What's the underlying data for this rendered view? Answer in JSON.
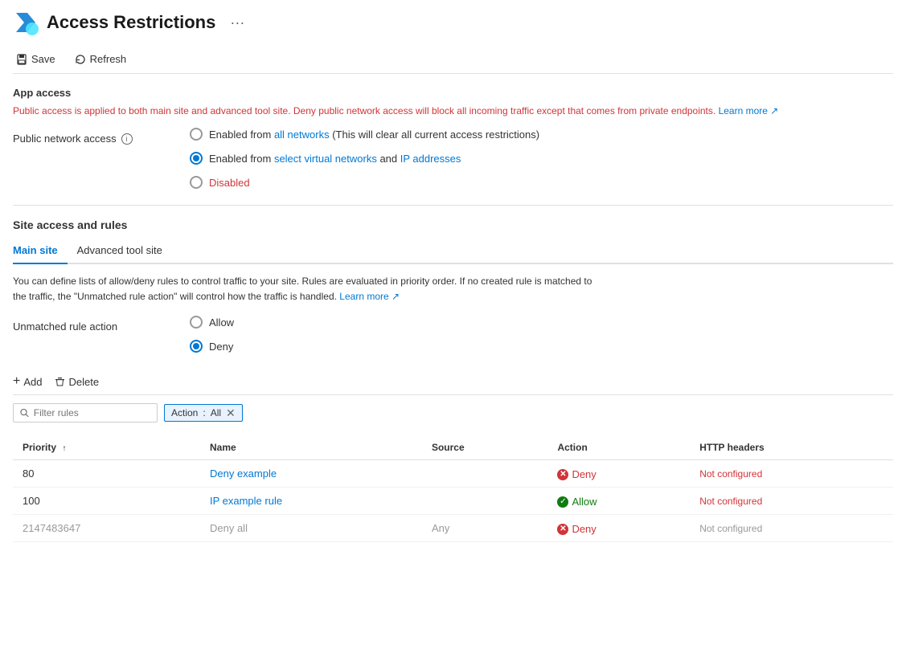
{
  "header": {
    "title": "Access Restrictions",
    "dots_label": "···"
  },
  "toolbar": {
    "save_label": "Save",
    "refresh_label": "Refresh"
  },
  "app_access": {
    "section_title": "App access",
    "info_text": "Public access is applied to both main site and advanced tool site. Deny public network access will block all incoming traffic except that comes from private endpoints.",
    "learn_more_label": "Learn more"
  },
  "public_network_access": {
    "label": "Public network access",
    "info_icon": "i",
    "options": [
      {
        "id": "all-networks",
        "label_start": "Enabled from ",
        "label_blue": "all networks",
        "label_end": " (This will clear all current access restrictions)",
        "selected": false
      },
      {
        "id": "select-networks",
        "label_start": "Enabled from ",
        "label_blue_1": "select virtual networks",
        "label_middle": " and ",
        "label_blue_2": "IP addresses",
        "selected": true
      },
      {
        "id": "disabled",
        "label": "Disabled",
        "selected": false
      }
    ]
  },
  "site_access": {
    "section_title": "Site access and rules",
    "tabs": [
      {
        "id": "main-site",
        "label": "Main site",
        "active": true
      },
      {
        "id": "advanced-tool-site",
        "label": "Advanced tool site",
        "active": false
      }
    ],
    "info_text_1": "You can define lists of allow/deny rules to control traffic to your site. Rules are evaluated in priority order. If no created rule is matched to",
    "info_text_2": "the traffic, the \"Unmatched rule action\" will control how the traffic is handled.",
    "learn_more_label": "Learn more"
  },
  "unmatched_rule": {
    "label": "Unmatched rule action",
    "options": [
      {
        "id": "allow",
        "label": "Allow",
        "selected": false
      },
      {
        "id": "deny",
        "label": "Deny",
        "selected": true
      }
    ]
  },
  "actions": {
    "add_label": "Add",
    "delete_label": "Delete"
  },
  "filter": {
    "placeholder": "Filter rules",
    "tag_label": "Action",
    "tag_separator": " : ",
    "tag_value": "All"
  },
  "table": {
    "columns": [
      {
        "id": "priority",
        "label": "Priority",
        "sort": "↑"
      },
      {
        "id": "name",
        "label": "Name"
      },
      {
        "id": "source",
        "label": "Source"
      },
      {
        "id": "action",
        "label": "Action"
      },
      {
        "id": "http-headers",
        "label": "HTTP headers"
      }
    ],
    "rows": [
      {
        "priority": "80",
        "name": "Deny example",
        "source": "",
        "action": "Deny",
        "action_type": "deny",
        "http_headers": "Not configured",
        "http_headers_type": "red",
        "dimmed": false
      },
      {
        "priority": "100",
        "name": "IP example rule",
        "source": "",
        "action": "Allow",
        "action_type": "allow",
        "http_headers": "Not configured",
        "http_headers_type": "red",
        "dimmed": false
      },
      {
        "priority": "2147483647",
        "name": "Deny all",
        "source": "Any",
        "action": "Deny",
        "action_type": "deny",
        "http_headers": "Not configured",
        "http_headers_type": "grey",
        "dimmed": true
      }
    ]
  }
}
